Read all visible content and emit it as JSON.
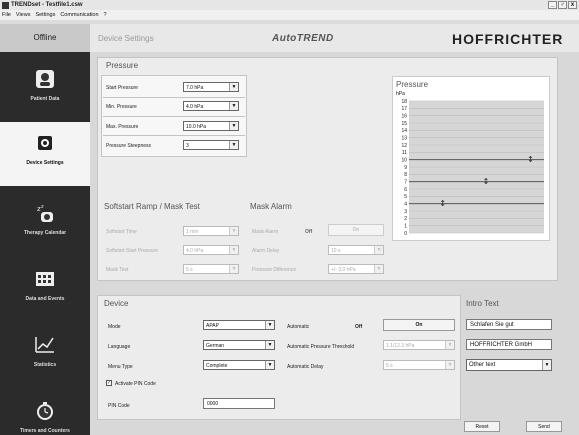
{
  "window": {
    "title": "TRENDset - Testfile1.csw",
    "buttons": [
      "_",
      "♂",
      "x"
    ]
  },
  "menu": [
    "File",
    "Views",
    "Settings",
    "Communication",
    "?"
  ],
  "header": {
    "status": "Offline",
    "section": "Device Settings",
    "product": "AutoTREND",
    "brand": "HOFFRICHTER"
  },
  "nav": [
    {
      "label": "Patient Data",
      "icon": "patient-data-icon"
    },
    {
      "label": "Device Settings",
      "icon": "device-settings-icon",
      "active": true
    },
    {
      "label": "Therapy Calendar",
      "icon": "therapy-calendar-icon"
    },
    {
      "label": "Data and Events",
      "icon": "data-events-icon"
    },
    {
      "label": "Statistics",
      "icon": "statistics-icon"
    },
    {
      "label": "Timers and Counters",
      "icon": "timers-counters-icon"
    }
  ],
  "pressure": {
    "title": "Pressure",
    "fields": [
      {
        "label": "Start Pressure",
        "value": "7.0 hPa"
      },
      {
        "label": "Min. Pressure",
        "value": "4.0 hPa"
      },
      {
        "label": "Max. Pressure",
        "value": "10.0 hPa"
      },
      {
        "label": "Pressure Steepness",
        "value": "3"
      }
    ]
  },
  "softstart": {
    "title": "Softstart Ramp / Mask Test",
    "fields": [
      {
        "label": "Softstart Time",
        "value": "1 min"
      },
      {
        "label": "Softstart Start Pressure",
        "value": "4.0 hPa"
      },
      {
        "label": "Mask Test",
        "value": "5 s"
      }
    ]
  },
  "mask_alarm": {
    "title": "Mask Alarm",
    "alarm": {
      "label": "Mask Alarm",
      "state": "Off",
      "button": "On"
    },
    "fields": [
      {
        "label": "Alarm Delay",
        "value": "10 s"
      },
      {
        "label": "Pressure Difference",
        "value": "+/- 3.0 hPa"
      }
    ]
  },
  "chart_data": {
    "type": "table",
    "title": "Pressure",
    "unit": "hPa",
    "ylim": [
      0,
      18
    ],
    "y_ticks": [
      "18",
      "17",
      "16",
      "15",
      "14",
      "13",
      "12",
      "11",
      "10",
      "9",
      "8",
      "7",
      "6",
      "5",
      "4",
      "3",
      "2",
      "1",
      "0"
    ],
    "reference_lines": [
      {
        "name": "Min. Pressure",
        "y": 4
      },
      {
        "name": "Start Pressure",
        "y": 7
      },
      {
        "name": "Max. Pressure",
        "y": 10
      }
    ],
    "grid": true
  },
  "device": {
    "title": "Device",
    "left": [
      {
        "label": "Mode",
        "value": "APAP"
      },
      {
        "label": "Language",
        "value": "German"
      },
      {
        "label": "Menu Type",
        "value": "Complete"
      }
    ],
    "pin_checkbox": {
      "label": "Activate PIN Code",
      "checked": true
    },
    "pin": {
      "label": "PIN Code",
      "value": "0000"
    },
    "automatic": {
      "label": "Automatic",
      "state": "Off",
      "button": "On"
    },
    "threshold": {
      "label": "Automatic Pressure Threshold",
      "value": "1.1/12.3 hPa"
    },
    "delay": {
      "label": "Automatic Delay",
      "value": "5 s"
    }
  },
  "intro": {
    "title": "Intro Text",
    "line1": "Schlafen Sie gut",
    "line2": "HOFFRICHTER GmbH",
    "select": "Other text"
  },
  "actions": {
    "reset": "Reset",
    "send": "Send"
  }
}
